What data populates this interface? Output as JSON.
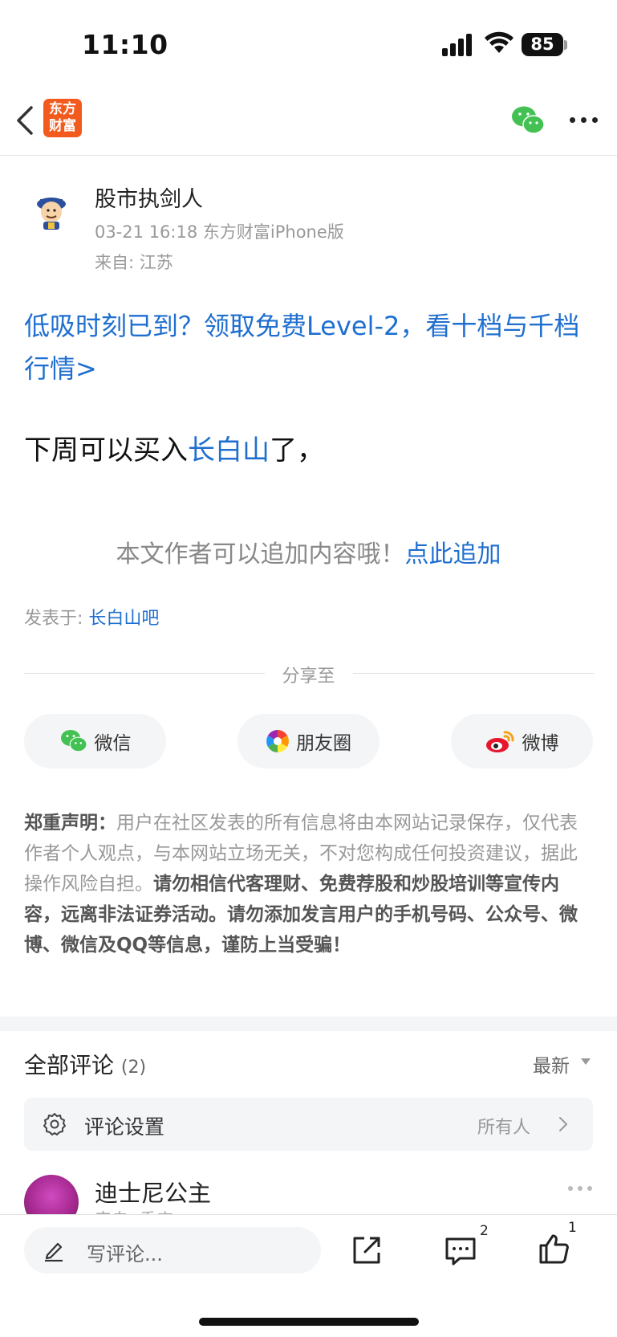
{
  "status": {
    "time": "11:10",
    "battery": "85"
  },
  "nav": {
    "logo_text": "东方财富"
  },
  "post": {
    "author": "股市执剑人",
    "meta": "03-21 16:18 东方财富iPhone版",
    "from": "来自: 江苏",
    "promo": "低吸时刻已到？领取免费Level-2，看十档与千档行情>",
    "body_before": "下周可以买入",
    "body_link": "长白山",
    "body_after": "了，",
    "append_text": "本文作者可以追加内容哦！",
    "append_link": "点此追加",
    "posted_label": "发表于: ",
    "posted_link": "长白山吧"
  },
  "share": {
    "title": "分享至",
    "buttons": [
      {
        "label": "微信"
      },
      {
        "label": "朋友圈"
      },
      {
        "label": "微博"
      }
    ]
  },
  "disclaimer": {
    "label": "郑重声明：",
    "text": "用户在社区发表的所有信息将由本网站记录保存，仅代表作者个人观点，与本网站立场无关，不对您构成任何投资建议，据此操作风险自担。",
    "bold": "请勿相信代客理财、免费荐股和炒股培训等宣传内容，远离非法证券活动。请勿添加发言用户的手机号码、公众号、微博、微信及QQ等信息，谨防上当受骗！"
  },
  "comments": {
    "title": "全部评论",
    "count": "(2)",
    "sort": "最新",
    "settings_label": "评论设置",
    "settings_value": "所有人",
    "items": [
      {
        "name": "迪士尼公主",
        "sub": "来自: 重庆"
      }
    ]
  },
  "bottom": {
    "placeholder": "写评论...",
    "comment_badge": "2",
    "like_badge": "1"
  },
  "colors": {
    "accent": "#1f6fd0",
    "brand": "#f25a1e"
  }
}
